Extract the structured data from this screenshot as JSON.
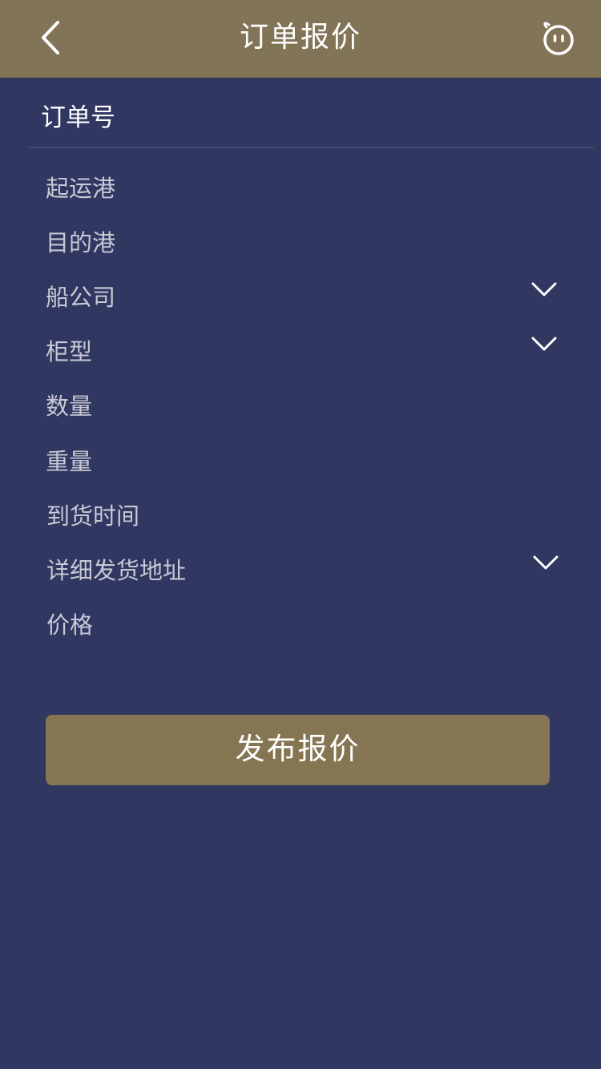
{
  "navbar": {
    "title": "订单报价",
    "back_icon": "chevron-left-icon",
    "right_icon": "emoji-face-icon",
    "background_color": "#827456"
  },
  "order": {
    "label": "订单号"
  },
  "fields": [
    {
      "label": "起运港",
      "has_dropdown": false
    },
    {
      "label": "目的港",
      "has_dropdown": false
    },
    {
      "label": "船公司",
      "has_dropdown": true
    },
    {
      "label": "柜型",
      "has_dropdown": true
    },
    {
      "label": "数量",
      "has_dropdown": false
    },
    {
      "label": "重量",
      "has_dropdown": false
    },
    {
      "label": "到货时间",
      "has_dropdown": false
    },
    {
      "label": "详细发货地址",
      "has_dropdown": true
    },
    {
      "label": "价格",
      "has_dropdown": false
    }
  ],
  "submit": {
    "label": "发布报价",
    "color": "#857552"
  },
  "theme": {
    "page_background": "#303760"
  }
}
